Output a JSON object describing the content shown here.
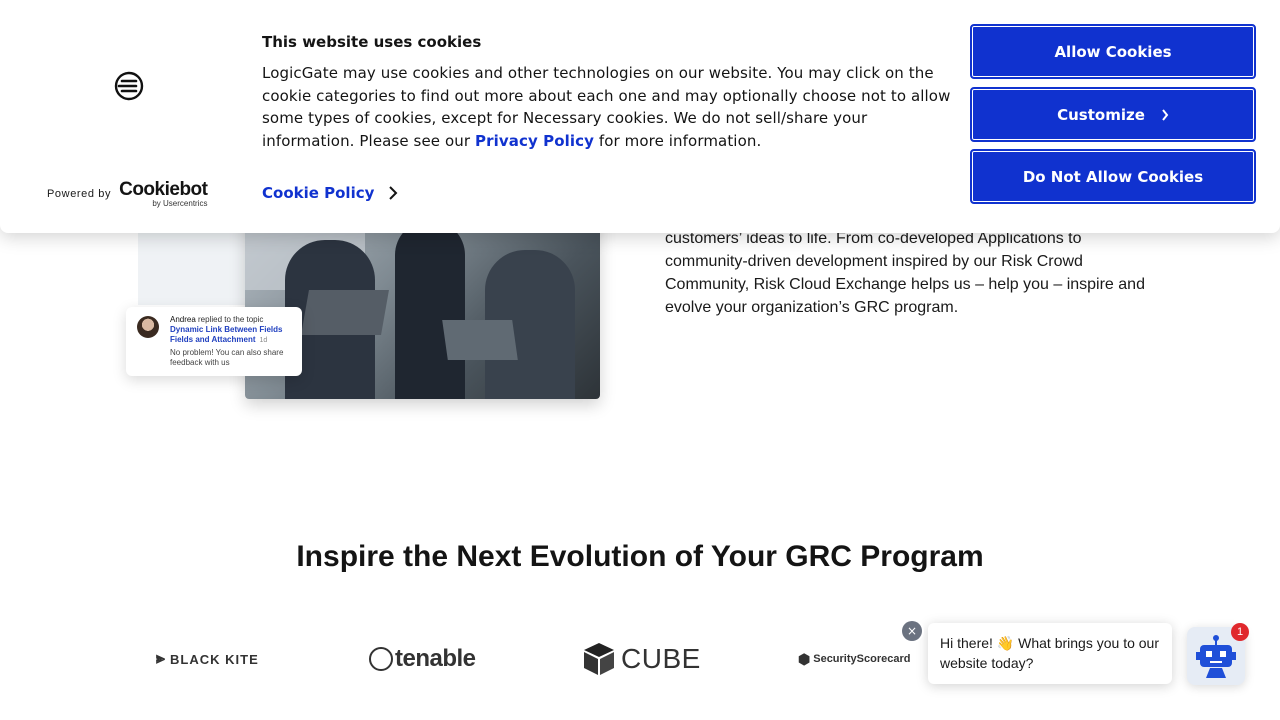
{
  "cookie_banner": {
    "title": "This website uses cookies",
    "body_text": "LogicGate may use cookies and other technologies on our website. You may click on the cookie categories to find out more about each one and may optionally choose not to allow some types of cookies, except for Necessary cookies.  We do not sell/share your information. Please see our ",
    "privacy_policy_label": "Privacy Policy",
    "body_tail": " for more information.",
    "cookie_policy_label": "Cookie Policy",
    "powered_by": "Powered by",
    "cookiebot_name": "Cookiebot",
    "cookiebot_by": "by Usercentrics",
    "buttons": {
      "allow": "Allow Cookies",
      "customize": "Customize",
      "deny": "Do Not Allow Cookies"
    },
    "accent_color": "#1032cf"
  },
  "hero": {
    "notification": {
      "author": "Andrea",
      "action": " replied to the topic",
      "topic": "Dynamic Link Between Fields Fields and Attachment",
      "ago": "1d",
      "message": "No problem! You can also share feedback with us"
    },
    "intro_text": "customers’ ideas to life. From co-developed Applications to community-driven development inspired by our Risk Crowd Community, Risk Cloud Exchange helps us – help you – inspire and evolve your organization’s GRC program."
  },
  "partners": {
    "heading": "Inspire the Next Evolution of Your GRC Program",
    "logos": [
      "BLACK KITE",
      "tenable",
      "CUBE",
      "SecurityScorecard"
    ]
  },
  "chat": {
    "greeting_start": "Hi there! ",
    "greeting_emoji": "👋",
    "greeting_end": " What brings you to our website today?",
    "badge_count": "1",
    "close_icon": "×"
  }
}
